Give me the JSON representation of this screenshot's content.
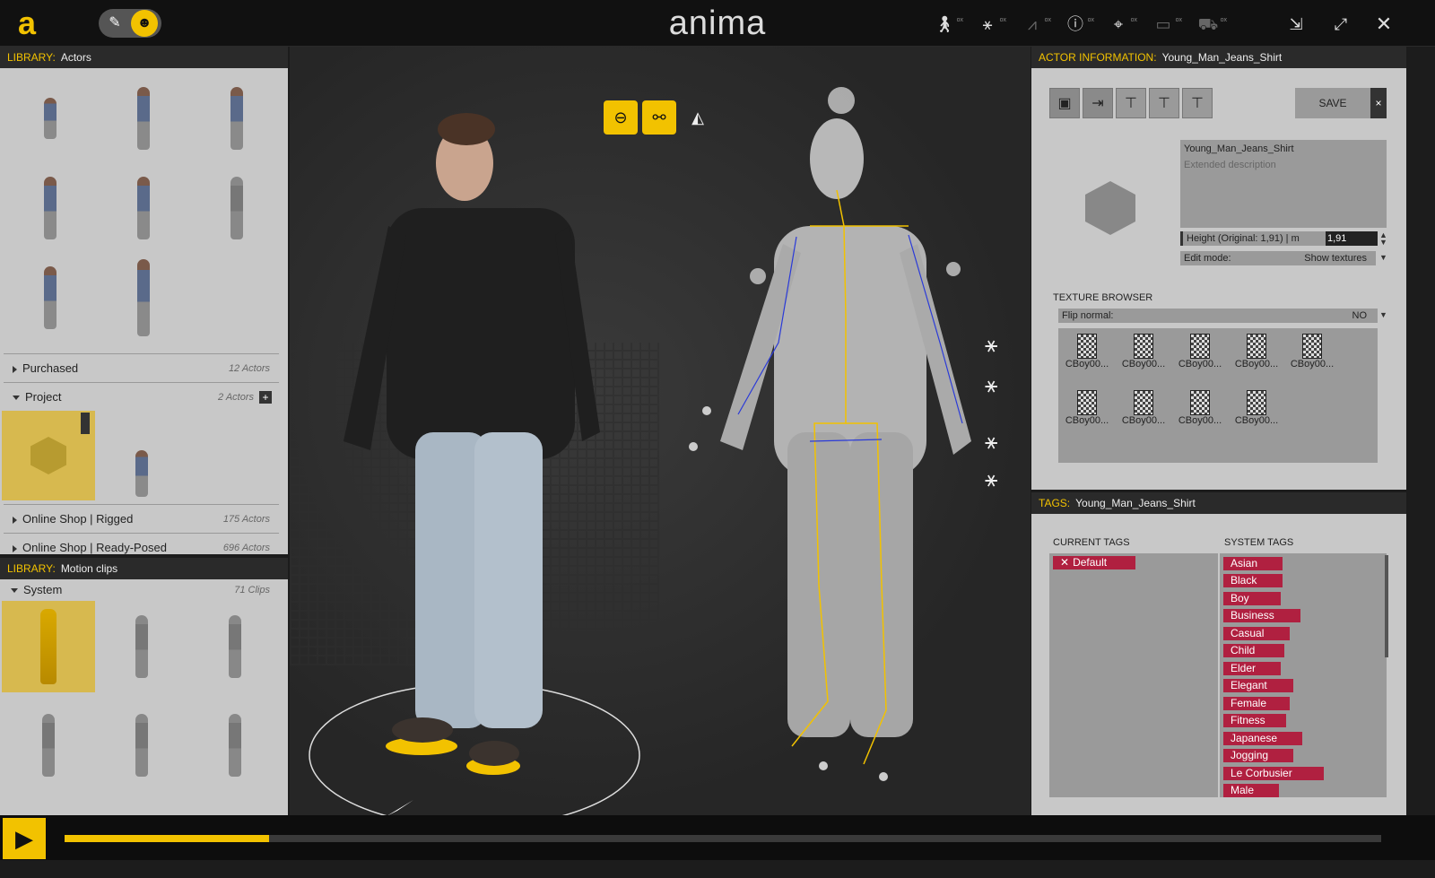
{
  "app": {
    "title": "anima"
  },
  "toolbar": {
    "icons": [
      "actor-icon",
      "motion-icon",
      "graph-icon",
      "info-icon",
      "tag-icon",
      "folder-icon",
      "cart-icon"
    ],
    "window": [
      "export-icon",
      "fullscreen-icon",
      "close-icon"
    ]
  },
  "library_actors": {
    "label": "LIBRARY:",
    "title": "Actors",
    "sections": [
      {
        "name": "Purchased",
        "count": "12 Actors"
      },
      {
        "name": "Project",
        "count": "2 Actors"
      },
      {
        "name": "Online Shop | Rigged",
        "count": "175 Actors"
      },
      {
        "name": "Online Shop | Ready-Posed",
        "count": "696 Actors"
      }
    ]
  },
  "library_motion": {
    "label": "LIBRARY:",
    "title": "Motion clips",
    "section": {
      "name": "System",
      "count": "71 Clips"
    }
  },
  "actor_info": {
    "label": "ACTOR INFORMATION:",
    "name": "Young_Man_Jeans_Shirt",
    "save": "SAVE",
    "close": "×",
    "description_name": "Young_Man_Jeans_Shirt",
    "description_placeholder": "Extended description",
    "height_label": "Height (Original: 1,91) | m",
    "height_value": "1,91",
    "edit_mode_label": "Edit mode:",
    "edit_mode_value": "Show textures",
    "texture_browser": "TEXTURE BROWSER",
    "flip_normal_label": "Flip normal:",
    "flip_normal_value": "NO",
    "textures": [
      "CBoy00...",
      "CBoy00...",
      "CBoy00...",
      "CBoy00...",
      "CBoy00...",
      "CBoy00...",
      "CBoy00...",
      "CBoy00...",
      "CBoy00..."
    ]
  },
  "tags": {
    "label": "TAGS:",
    "name": "Young_Man_Jeans_Shirt",
    "current_header": "CURRENT TAGS",
    "system_header": "SYSTEM TAGS",
    "current": [
      "Default"
    ],
    "system": [
      "Asian",
      "Black",
      "Boy",
      "Business",
      "Casual",
      "Child",
      "Elder",
      "Elegant",
      "Female",
      "Fitness",
      "Japanese",
      "Jogging",
      "Le Corbusier",
      "Male"
    ]
  },
  "timeline": {
    "progress": 0.155
  },
  "colors": {
    "accent": "#f2c200",
    "tag": "#b02040",
    "panel": "#c8c8c8"
  }
}
